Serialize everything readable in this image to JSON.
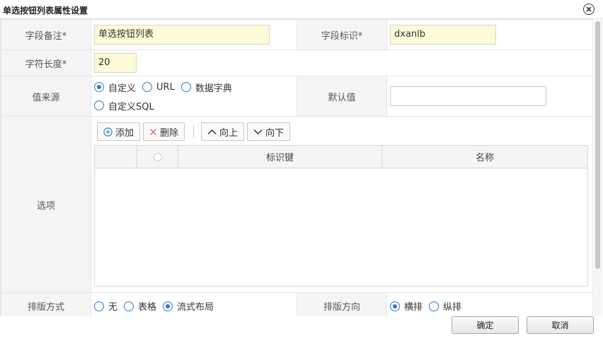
{
  "dialog": {
    "title": "单选按钮列表属性设置"
  },
  "fields": {
    "remark_label": "字段备注*",
    "remark_value": "单选按钮列表",
    "ident_label": "字段标识*",
    "ident_value": "dxanlb",
    "length_label": "字符长度*",
    "length_value": "20",
    "source_label": "值来源",
    "source_options": [
      "自定义",
      "URL",
      "数据字典",
      "自定义SQL"
    ],
    "source_selected": "自定义",
    "default_label": "默认值",
    "default_value": "",
    "options_label": "选项",
    "layout_label": "排版方式",
    "layout_options": [
      "无",
      "表格",
      "流式布局"
    ],
    "layout_selected": "流式布局",
    "direction_label": "排版方向",
    "direction_options": [
      "横排",
      "纵排"
    ],
    "direction_selected": "横排"
  },
  "toolbar": {
    "add": "添加",
    "delete": "删除",
    "up": "向上",
    "down": "向下"
  },
  "grid": {
    "col_key": "标识键",
    "col_name": "名称"
  },
  "footer": {
    "ok": "确定",
    "cancel": "取消"
  },
  "colors": {
    "accent": "#2c7bc8",
    "input_bg": "#fdfbd8",
    "label_bg": "#f5f5f5",
    "delete_icon": "#e24b4b"
  }
}
